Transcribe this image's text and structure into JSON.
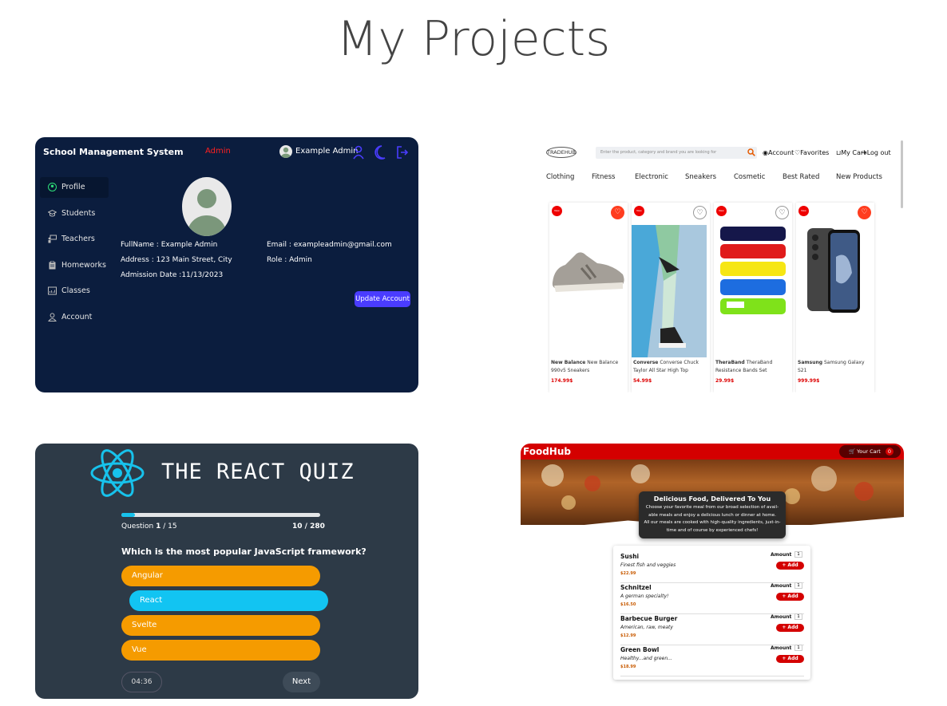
{
  "page": {
    "title": "My Projects"
  },
  "school": {
    "title": "School Management System",
    "role_tag": "Admin",
    "user": "Example Admin",
    "nav": [
      "Profile",
      "Students",
      "Teachers",
      "Homeworks",
      "Classes",
      "Account"
    ],
    "fullname": "FullName : Example Admin",
    "address": "Address : 123 Main Street, City",
    "admission": "Admission Date :11/13/2023",
    "email": "Email : exampleadmin@gmail.com",
    "role": "Role : Admin",
    "update_button": "Update Account",
    "colors": {
      "bg": "#0b1d3e",
      "accent": "#4a3cff",
      "admin": "#ff2020"
    }
  },
  "tradehub": {
    "logo": "TRADEHUB",
    "search_placeholder": "Enter the product, category and brand you are looking for",
    "account": "Account",
    "favorites": "Favorites",
    "cart": "My Cart",
    "logout": "Log out",
    "categories": [
      "Clothing",
      "Fitness",
      "Electronic",
      "Sneakers",
      "Cosmetic",
      "Best Rated",
      "New Products"
    ],
    "products": [
      {
        "brand": "New Balance",
        "name": "New Balance 990v5 Sneakers",
        "price": "174.99$",
        "heart": "red"
      },
      {
        "brand": "Converse",
        "name": "Converse Chuck Taylor All Star High Top",
        "price": "54.99$",
        "heart": "white"
      },
      {
        "brand": "TheraBand",
        "name": "TheraBand Resistance Bands Set",
        "price": "29.99$",
        "heart": "white"
      },
      {
        "brand": "Samsung",
        "name": "Samsung Galaxy S21",
        "price": "999.99$",
        "heart": "red"
      }
    ]
  },
  "quiz": {
    "title": "THE REACT QUIZ",
    "question_label": "Question",
    "question_current": "1",
    "question_total": " / 15",
    "points": "10 / 280",
    "progress": 0.067,
    "question": "Which is the most popular JavaScript framework?",
    "options": [
      "Angular",
      "React",
      "Svelte",
      "Vue"
    ],
    "selected": "React",
    "timer": "04:36",
    "next": "Next"
  },
  "foodhub": {
    "brand": "FoodHub",
    "cart_label": "Your Cart",
    "cart_count": "0",
    "hero_title": "Delicious Food, Delivered To You",
    "hero_text1": "Choose your favorite meal from our broad selection of avail-able meals and enjoy a delicious lunch or dinner at home.",
    "hero_text2": "All our meals are cooked with high-quality ingredients, just-in-time and of course by experienced chefs!",
    "amount_label": "Amount",
    "add_label": "+ Add",
    "meals": [
      {
        "name": "Sushi",
        "desc": "Finest fish and veggies",
        "price": "$22.99",
        "amount": "1"
      },
      {
        "name": "Schnitzel",
        "desc": "A german specialty!",
        "price": "$16.50",
        "amount": "1"
      },
      {
        "name": "Barbecue Burger",
        "desc": "American, raw, meaty",
        "price": "$12.99",
        "amount": "1"
      },
      {
        "name": "Green Bowl",
        "desc": "Healthy...and green...",
        "price": "$18.99",
        "amount": "1"
      }
    ]
  }
}
